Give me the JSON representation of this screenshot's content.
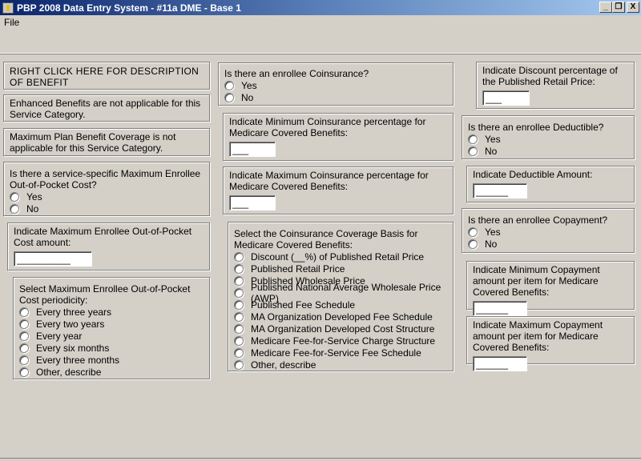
{
  "window": {
    "title": "PBP 2008 Data Entry System - #11a DME - Base 1",
    "min": "_",
    "restore": "❐",
    "close": "X"
  },
  "menu": {
    "file": "File"
  },
  "left": {
    "description": "RIGHT CLICK HERE FOR DESCRIPTION OF BENEFIT",
    "enhanced": "Enhanced Benefits are not applicable for this Service Category.",
    "max_plan": "Maximum Plan Benefit Coverage is not applicable for this Service Category.",
    "oop_question": "Is there a service-specific Maximum Enrollee Out-of-Pocket Cost?",
    "yes": "Yes",
    "no": "No",
    "oop_amount_label": "Indicate Maximum Enrollee Out-of-Pocket Cost amount:",
    "oop_amount_value": "__________",
    "periodicity_label": "Select Maximum Enrollee Out-of-Pocket Cost periodicity:",
    "periodicity_options": [
      "Every three years",
      "Every two years",
      "Every year",
      "Every six months",
      "Every three months",
      "Other, describe"
    ]
  },
  "middle": {
    "coins_question": "Is there an enrollee Coinsurance?",
    "yes": "Yes",
    "no": "No",
    "min_coins_label": "Indicate Minimum Coinsurance percentage for Medicare Covered Benefits:",
    "min_coins_value": "___",
    "max_coins_label": "Indicate Maximum Coinsurance percentage for Medicare Covered Benefits:",
    "max_coins_value": "___",
    "basis_label": "Select the Coinsurance Coverage Basis for Medicare Covered Benefits:",
    "basis_options": [
      "Discount (__%) of Published Retail Price",
      "Published Retail Price",
      "Published Wholesale Price",
      "Published National Average Wholesale Price (AWP)",
      "Published Fee Schedule",
      "MA Organization Developed Fee Schedule",
      "MA Organization Developed Cost Structure",
      "Medicare Fee-for-Service Charge Structure",
      "Medicare Fee-for-Service Fee Schedule",
      "Other, describe"
    ]
  },
  "right": {
    "discount_label": "Indicate Discount percentage of the Published Retail Price:",
    "discount_value": "___",
    "deductible_question": "Is there an enrollee Deductible?",
    "yes": "Yes",
    "no": "No",
    "deductible_amount_label": "Indicate Deductible Amount:",
    "deductible_amount_value": "______",
    "copay_question": "Is there an enrollee Copayment?",
    "min_copay_label": "Indicate Minimum Copayment amount per item for Medicare Covered Benefits:",
    "min_copay_value": "______",
    "max_copay_label": "Indicate Maximum Copayment amount per item for Medicare Covered Benefits:",
    "max_copay_value": "______"
  }
}
